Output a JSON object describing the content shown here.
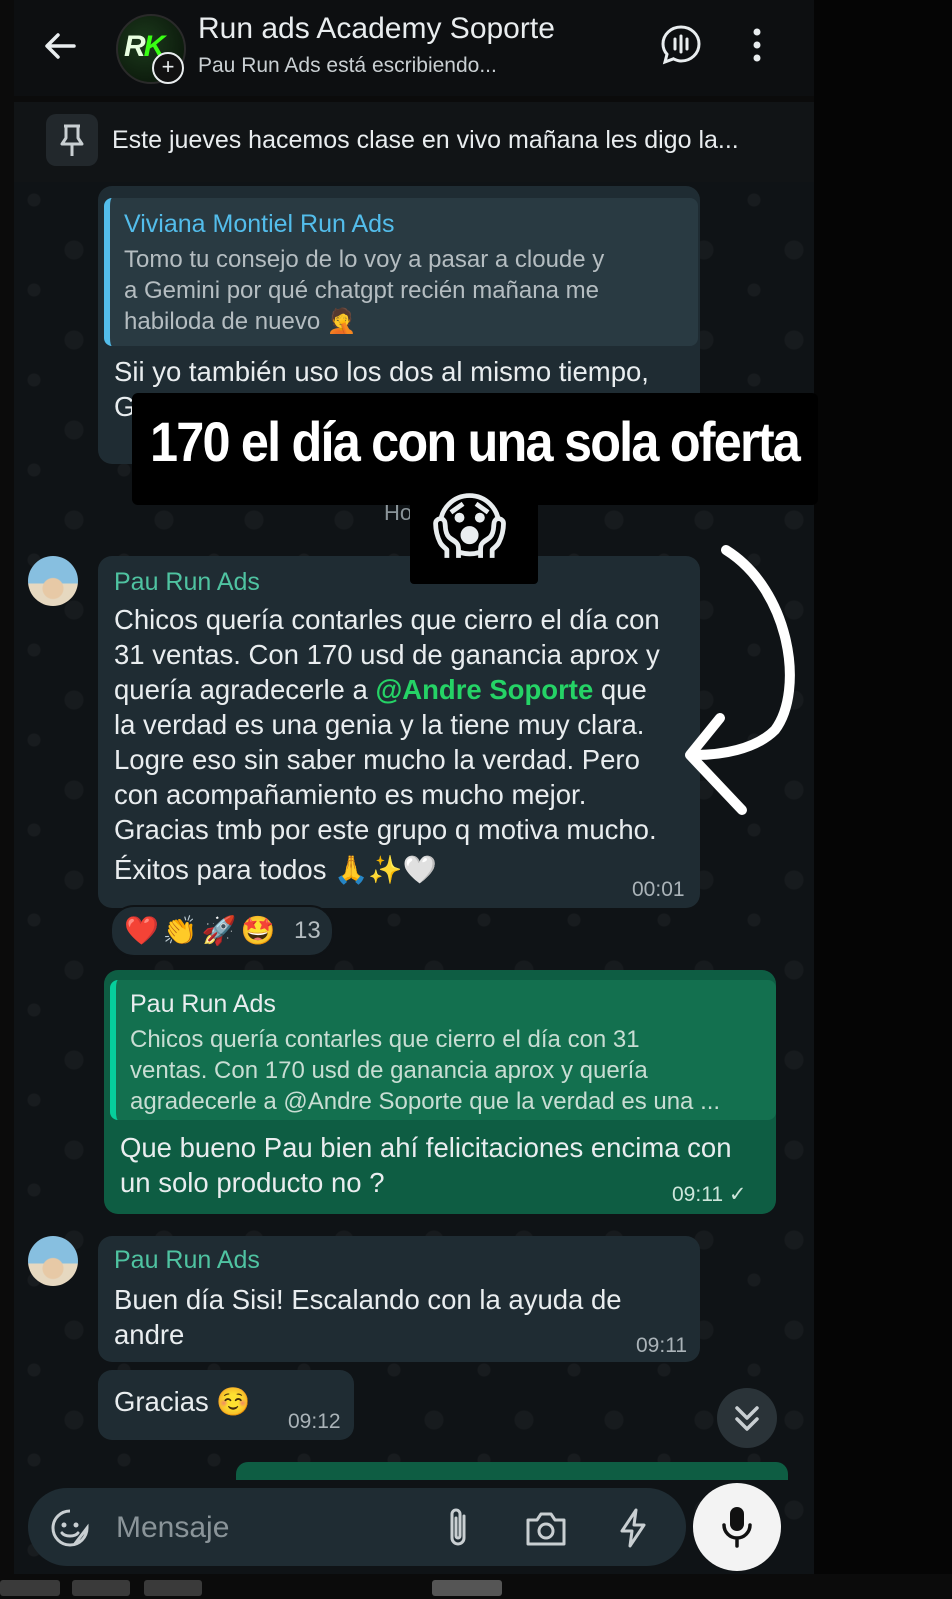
{
  "header": {
    "back_icon": "arrow-left-icon",
    "group_avatar_text": "RK",
    "title": "Run ads Academy Soporte",
    "status": "Pau Run Ads está escribiendo...",
    "voice_chat_icon": "voice-chat-icon",
    "menu_icon": "more-vertical-icon"
  },
  "pinned": {
    "icon": "pin-icon",
    "text": "Este jueves hacemos clase en vivo mañana les digo la..."
  },
  "messages": [
    {
      "type": "incoming-reply",
      "quote_sender": "Viviana Montiel Run Ads",
      "quote_line1": "Tomo tu consejo de lo voy a pasar a cloude y",
      "quote_line2": "a Gemini por qué chatgpt recién mañana me",
      "quote_line3": "habiloda de nuevo 🤦",
      "text_line1": "Sii yo también uso los dos al mismo tiempo,",
      "text_line2": "G"
    },
    {
      "type": "incoming",
      "sender": "Pau Run Ads",
      "line1": "Chicos quería contarles que cierro el día con",
      "line2": "31 ventas. Con 170 usd de ganancia aprox y",
      "line3_pre": "quería agradecerle a ",
      "line3_mention": "@Andre Soporte",
      "line3_post": " que",
      "line4": "la verdad es una genia y la tiene muy clara.",
      "line5": "Logre eso sin saber mucho la verdad. Pero",
      "line6": "con acompañamiento es mucho mejor.",
      "line7": "Gracias tmb por este grupo q motiva mucho.",
      "line8": "Éxitos para todos 🙏✨🤍",
      "time": "00:01",
      "reactions": "❤️👏🚀🤩",
      "reaction_count": "13"
    },
    {
      "type": "outgoing-reply",
      "quote_sender": "Pau Run Ads",
      "quote_line1": "Chicos quería contarles que cierro el día con 31",
      "quote_line2": "ventas. Con 170 usd de ganancia aprox y quería",
      "quote_line3": "agradecerle a @Andre Soporte que la verdad es una ...",
      "line1": "Que bueno Pau bien ahí felicitaciones encima con",
      "line2": "un solo producto no ?",
      "time": "09:11 ✓"
    },
    {
      "type": "incoming",
      "sender": "Pau Run Ads",
      "line1": "Buen día Sisi! Escalando con la ayuda de",
      "line2": "andre",
      "time": "09:11"
    },
    {
      "type": "incoming",
      "text": "Gracias ☺️",
      "time": "09:12"
    }
  ],
  "hidden_fragment": "Ho",
  "overlay": {
    "caption": "170 el día con una sola oferta",
    "emoji": "😱",
    "arrow": "hand-drawn-curved-arrow"
  },
  "composer": {
    "placeholder": "Mensaje",
    "emoji_icon": "sticker-smile-icon",
    "attach_icon": "paperclip-icon",
    "camera_icon": "camera-icon",
    "bolt_icon": "lightning-icon",
    "mic_icon": "microphone-icon"
  },
  "scroll_down_icon": "double-chevron-down-icon"
}
